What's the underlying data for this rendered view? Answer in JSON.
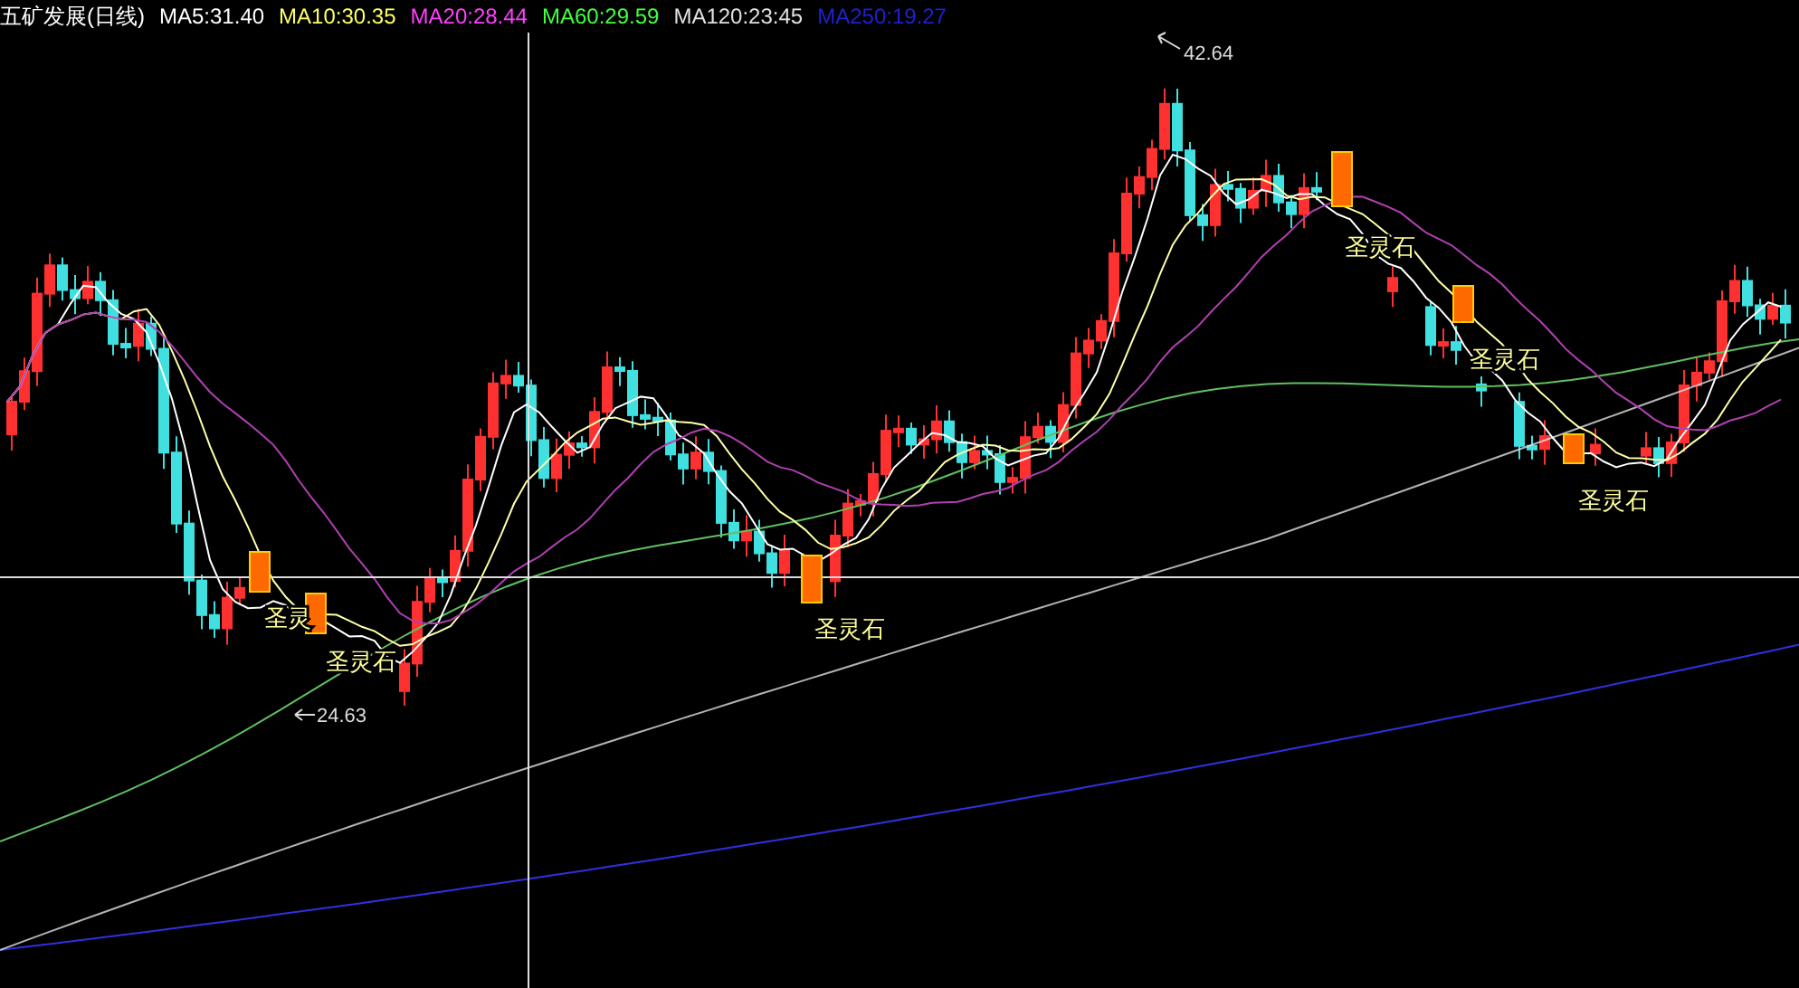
{
  "header": {
    "title": "五矿发展(日线)",
    "indicators": [
      {
        "text": "MA5:31.40",
        "color": "#ffffff"
      },
      {
        "text": "MA10:30.35",
        "color": "#ffff66"
      },
      {
        "text": "MA20:28.44",
        "color": "#ff40ff"
      },
      {
        "text": "MA60:29.59",
        "color": "#40ff40"
      },
      {
        "text": "MA120:23:45",
        "color": "#e0e0e0"
      },
      {
        "text": "MA250:19.27",
        "color": "#2020d0"
      }
    ]
  },
  "price_marks": [
    {
      "kind": "high",
      "text": "42.64"
    },
    {
      "kind": "low",
      "text": "24.63"
    }
  ],
  "signals": [
    {
      "text": "圣灵"
    },
    {
      "text": "圣灵石"
    },
    {
      "text": "圣灵石"
    },
    {
      "text": "圣灵石"
    },
    {
      "text": "圣灵石"
    },
    {
      "text": "圣灵石"
    }
  ]
}
